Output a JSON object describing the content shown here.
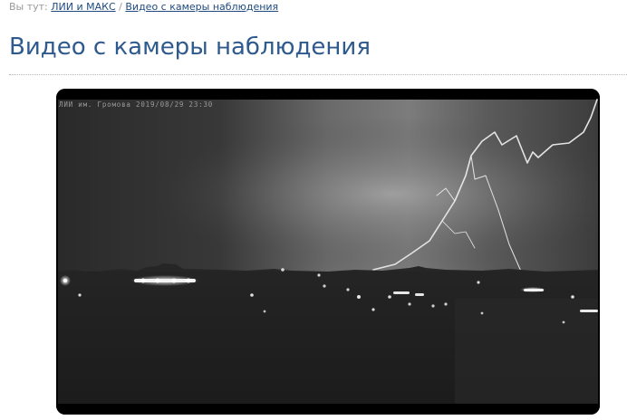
{
  "breadcrumb": {
    "prefix": "Вы тут:",
    "parent_link": "ЛИИ и МАКС",
    "separator": "/",
    "current_link": "Видео с камеры наблюдения"
  },
  "page": {
    "title": "Видео с камеры наблюдения"
  },
  "video": {
    "camera_caption": "ЛИИ им. Громова 2019/08/29 23:30"
  }
}
